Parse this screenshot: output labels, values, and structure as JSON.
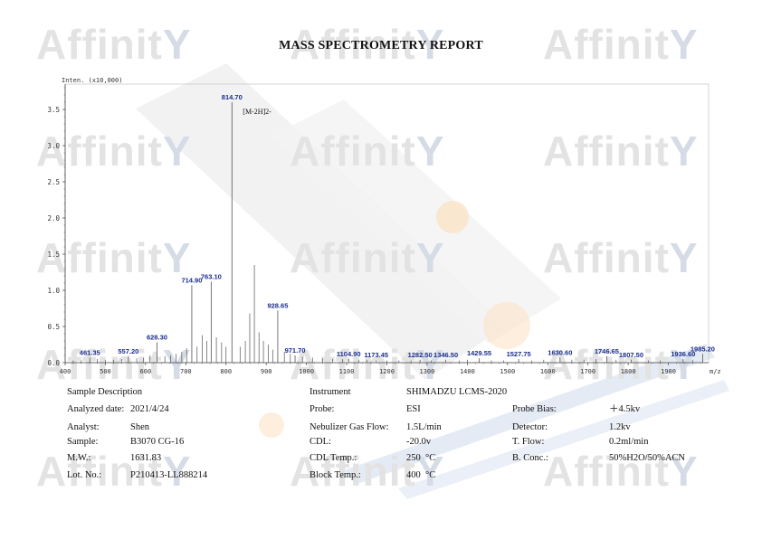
{
  "report": {
    "title": "MASS SPECTROMETRY REPORT",
    "watermark_text": "Affinit"
  },
  "chart_data": {
    "type": "line",
    "subtype": "mass-spectrum-stick",
    "ylabel": "Inten. (x10,000)",
    "xlabel": "m/z",
    "xlim": [
      400,
      2000
    ],
    "ylim": [
      0,
      3.85
    ],
    "x_ticks": [
      400,
      500,
      600,
      700,
      800,
      900,
      1000,
      1100,
      1200,
      1300,
      1400,
      1500,
      1600,
      1700,
      1800,
      1900
    ],
    "y_ticks": [
      0.0,
      0.5,
      1.0,
      1.5,
      2.0,
      2.5,
      3.0,
      3.5
    ],
    "annotation": "[M-2H]2-",
    "colors": {
      "peak_label": "#1a2d8c",
      "axis": "#444444",
      "stick": "#555555"
    },
    "labeled_peaks": [
      {
        "x": 461.35,
        "y": 0.07,
        "label": "461.35"
      },
      {
        "x": 557.2,
        "y": 0.09,
        "label": "557.20"
      },
      {
        "x": 628.3,
        "y": 0.28,
        "label": "628.30"
      },
      {
        "x": 714.9,
        "y": 1.07,
        "label": "714.90"
      },
      {
        "x": 763.1,
        "y": 1.12,
        "label": "763.10"
      },
      {
        "x": 814.7,
        "y": 3.6,
        "label": "814.70"
      },
      {
        "x": 928.65,
        "y": 0.72,
        "label": "928.65"
      },
      {
        "x": 971.7,
        "y": 0.1,
        "label": "971.70"
      },
      {
        "x": 1104.9,
        "y": 0.05,
        "label": "1104.90"
      },
      {
        "x": 1173.45,
        "y": 0.03,
        "label": "1173.45"
      },
      {
        "x": 1282.5,
        "y": 0.04,
        "label": "1282.50"
      },
      {
        "x": 1346.5,
        "y": 0.04,
        "label": "1346.50"
      },
      {
        "x": 1429.55,
        "y": 0.06,
        "label": "1429.55"
      },
      {
        "x": 1527.75,
        "y": 0.05,
        "label": "1527.75"
      },
      {
        "x": 1630.6,
        "y": 0.07,
        "label": "1630.60"
      },
      {
        "x": 1746.65,
        "y": 0.09,
        "label": "1746.65"
      },
      {
        "x": 1807.5,
        "y": 0.04,
        "label": "1807.50"
      },
      {
        "x": 1936.6,
        "y": 0.05,
        "label": "1936.60"
      },
      {
        "x": 1985.2,
        "y": 0.12,
        "label": "1985.20"
      }
    ],
    "other_peaks": [
      {
        "x": 870.5,
        "y": 1.35
      },
      {
        "x": 859.0,
        "y": 0.68
      },
      {
        "x": 848.0,
        "y": 0.3
      },
      {
        "x": 835.0,
        "y": 0.22
      },
      {
        "x": 882.0,
        "y": 0.42
      },
      {
        "x": 893.0,
        "y": 0.3
      },
      {
        "x": 905.0,
        "y": 0.25
      },
      {
        "x": 916.0,
        "y": 0.18
      },
      {
        "x": 800.0,
        "y": 0.22
      },
      {
        "x": 789.0,
        "y": 0.28
      },
      {
        "x": 776.0,
        "y": 0.35
      },
      {
        "x": 752.0,
        "y": 0.3
      },
      {
        "x": 741.0,
        "y": 0.38
      },
      {
        "x": 728.0,
        "y": 0.22
      },
      {
        "x": 702.0,
        "y": 0.2
      },
      {
        "x": 690.0,
        "y": 0.15
      },
      {
        "x": 676.0,
        "y": 0.12
      },
      {
        "x": 662.0,
        "y": 0.1
      },
      {
        "x": 648.0,
        "y": 0.09
      },
      {
        "x": 611.0,
        "y": 0.1
      },
      {
        "x": 595.0,
        "y": 0.07
      },
      {
        "x": 578.0,
        "y": 0.06
      },
      {
        "x": 540.0,
        "y": 0.05
      },
      {
        "x": 520.0,
        "y": 0.04
      },
      {
        "x": 500.0,
        "y": 0.04
      },
      {
        "x": 480.0,
        "y": 0.05
      },
      {
        "x": 440.0,
        "y": 0.03
      },
      {
        "x": 420.0,
        "y": 0.03
      },
      {
        "x": 945.0,
        "y": 0.15
      },
      {
        "x": 960.0,
        "y": 0.12
      },
      {
        "x": 990.0,
        "y": 0.08
      },
      {
        "x": 1015.0,
        "y": 0.07
      },
      {
        "x": 1040.0,
        "y": 0.06
      },
      {
        "x": 1065.0,
        "y": 0.05
      },
      {
        "x": 1090.0,
        "y": 0.05
      },
      {
        "x": 1130.0,
        "y": 0.04
      },
      {
        "x": 1150.0,
        "y": 0.04
      },
      {
        "x": 1200.0,
        "y": 0.03
      },
      {
        "x": 1230.0,
        "y": 0.03
      },
      {
        "x": 1260.0,
        "y": 0.03
      },
      {
        "x": 1310.0,
        "y": 0.03
      },
      {
        "x": 1380.0,
        "y": 0.03
      },
      {
        "x": 1400.0,
        "y": 0.04
      },
      {
        "x": 1460.0,
        "y": 0.03
      },
      {
        "x": 1490.0,
        "y": 0.03
      },
      {
        "x": 1560.0,
        "y": 0.03
      },
      {
        "x": 1590.0,
        "y": 0.04
      },
      {
        "x": 1660.0,
        "y": 0.04
      },
      {
        "x": 1690.0,
        "y": 0.04
      },
      {
        "x": 1720.0,
        "y": 0.05
      },
      {
        "x": 1770.0,
        "y": 0.04
      },
      {
        "x": 1850.0,
        "y": 0.03
      },
      {
        "x": 1880.0,
        "y": 0.03
      },
      {
        "x": 1960.0,
        "y": 0.04
      }
    ]
  },
  "info": {
    "sample_description": "Sample Description",
    "analyzed_date": {
      "label": "Analyzed date:",
      "value": "2021/4/24"
    },
    "analyst": {
      "label": "Analyst:",
      "value": "Shen"
    },
    "sample": {
      "label": "Sample:",
      "value": "B3070 CG-16"
    },
    "mw": {
      "label": "M.W.:",
      "value": "1631.83"
    },
    "lot": {
      "label": "Lot. No.:",
      "value": "P210413-LL888214"
    },
    "instrument": {
      "label": "Instrument",
      "value": "SHIMADZU LCMS-2020"
    },
    "probe": {
      "label": "Probe:",
      "value": "ESI"
    },
    "nebulizer": {
      "label": "Nebulizer Gas Flow:",
      "value": "1.5L/min"
    },
    "cdl": {
      "label": "CDL:",
      "value": "-20.0v"
    },
    "cdl_temp": {
      "label": "CDL Temp.:",
      "value": "250",
      "unit": "°C"
    },
    "block_temp": {
      "label": "Block Temp.:",
      "value": "400",
      "unit": "°C"
    },
    "probe_bias": {
      "label": "Probe Bias:",
      "value": "＋4.5kv"
    },
    "detector": {
      "label": "Detector:",
      "value": "1.2kv"
    },
    "t_flow": {
      "label": "T. Flow:",
      "value": "0.2ml/min"
    },
    "b_conc": {
      "label": "B. Conc.:",
      "value": "50%H2O/50%ACN"
    }
  }
}
